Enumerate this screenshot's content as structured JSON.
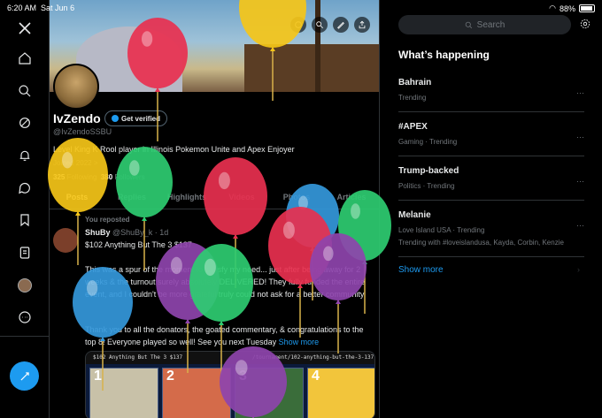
{
  "status_bar": {
    "time": "6:20 AM",
    "date": "Sat Jun 6",
    "battery": "88%"
  },
  "profile": {
    "name": "IvZendo",
    "get_verified": "Get verified",
    "handle": "@IvZendoSSBU",
    "bio": "Level King K Rool player in Illinois Pokemon Unite and Apex Enjoyer",
    "joined": "Joined 2022 >",
    "following_count": "325",
    "following_label": "Following",
    "followers_count": "380",
    "followers_label": "Followers",
    "tabs": [
      "Posts",
      "Replies",
      "Highlights",
      "Videos",
      "Photos",
      "Articles"
    ]
  },
  "tweet": {
    "repost_label": "You reposted",
    "author": "ShuBy",
    "handle": "@ShuBy_k · 1d",
    "line1": "$102 Anything But The 3 $137",
    "body1": "This was a spur of the moment to satisfy my need... just after being away for 2 weeks & the turnout surely absolutely DELIVERED! They fully funded the entire event, and I couldn't be more grateful truly could not ask for a better community.",
    "body2": "Thank you to all the donators, the goated commentary, & congratulations to the top 8! Everyone played so well! See you next Tuesday",
    "show_more": "Show more",
    "card_title": "$102 Anything But The 3 $137",
    "card_url": "/tournament/102-anything-but-the-3-137",
    "card_nums": [
      "1",
      "2",
      "3",
      "4"
    ]
  },
  "sidebar": {
    "search_placeholder": "Search",
    "heading": "What’s happening",
    "trends": [
      {
        "title": "Bahrain",
        "context": "Trending",
        "extra": ""
      },
      {
        "title": "#APEX",
        "context": "Gaming · Trending",
        "extra": ""
      },
      {
        "title": "Trump-backed",
        "context": "Politics · Trending",
        "extra": ""
      },
      {
        "title": "Melanie",
        "context": "Love Island USA · Trending",
        "extra": "Trending with #loveislandusa, Kayda, Corbin, Kenzie"
      }
    ],
    "show_more": "Show more",
    "more_icon": "···"
  },
  "colors": {
    "accent": "#1d9bf0",
    "background": "#000000",
    "border": "#2f3336",
    "muted": "#71767b"
  },
  "balloon_colors": [
    "#f5c518",
    "#e8304f",
    "#f5c518",
    "#2ecc71",
    "#e8304f",
    "#3498db",
    "#2ecc71",
    "#e8304f",
    "#8e44ad",
    "#2ecc71",
    "#3498db",
    "#8e44ad",
    "#8e44ad"
  ]
}
